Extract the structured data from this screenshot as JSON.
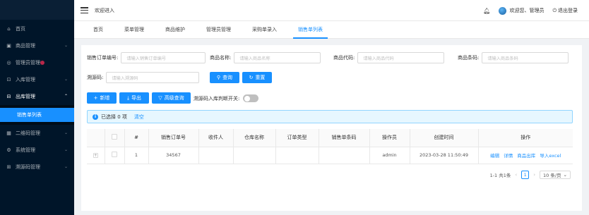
{
  "header": {
    "title": "欢迎进入",
    "user_label": "欢迎您、管理员",
    "logout_label": "退出登录"
  },
  "sidebar": {
    "items": [
      {
        "label": "首页",
        "icon": "home-icon"
      },
      {
        "label": "商品管理",
        "icon": "box-icon"
      },
      {
        "label": "管理员管理",
        "icon": "user-icon"
      },
      {
        "label": "入库管理",
        "icon": "inbox-icon"
      },
      {
        "label": "出库管理",
        "icon": "outbox-icon"
      },
      {
        "label": "销售单列表",
        "icon": ""
      },
      {
        "label": "二维码管理",
        "icon": "qrcode-icon"
      },
      {
        "label": "系统管理",
        "icon": "settings-icon"
      },
      {
        "label": "溯源码管理",
        "icon": "trace-icon"
      }
    ]
  },
  "tabs": [
    {
      "label": "首页"
    },
    {
      "label": "菜单管理"
    },
    {
      "label": "商品维护"
    },
    {
      "label": "管理员管理"
    },
    {
      "label": "采购单录入"
    },
    {
      "label": "销售单列表"
    }
  ],
  "filters": {
    "order_no": {
      "label": "销售订单编号:",
      "placeholder": "请输入销售订单编号"
    },
    "product_name": {
      "label": "商品名称:",
      "placeholder": "请输入商品名称"
    },
    "product_code": {
      "label": "商品代码:",
      "placeholder": "请输入商品代码"
    },
    "product_barcode": {
      "label": "商品条码:",
      "placeholder": "请输入商品条码"
    },
    "trace_code": {
      "label": "溯源码:",
      "placeholder": "请输入溯源码"
    },
    "search_label": "查询",
    "reset_label": "重置"
  },
  "toolbar": {
    "add_label": "新增",
    "export_label": "导出",
    "advanced_label": "高级查询",
    "switch_label": "溯源码入库判断开关:"
  },
  "selection": {
    "text": "已选择 0 项",
    "clear_label": "清空"
  },
  "table": {
    "columns": [
      "",
      "",
      "#",
      "销售订单号",
      "收件人",
      "仓库名称",
      "订单类型",
      "销售单条码",
      "操作员",
      "创建时间",
      "操作"
    ],
    "rows": [
      {
        "index": "1",
        "order_no": "34567",
        "recipient": "",
        "warehouse": "",
        "order_type": "",
        "barcode": "",
        "operator": "admin",
        "created_at": "2023-03-28 11:50:49",
        "actions": [
          "编辑",
          "详情",
          "商品出库",
          "导入excel"
        ]
      }
    ]
  },
  "pagination": {
    "summary": "1-1 共1条",
    "current_page": "1",
    "page_size": "10 条/页"
  },
  "colors": {
    "primary": "#1890ff",
    "sidebar_bg": "#001529"
  }
}
